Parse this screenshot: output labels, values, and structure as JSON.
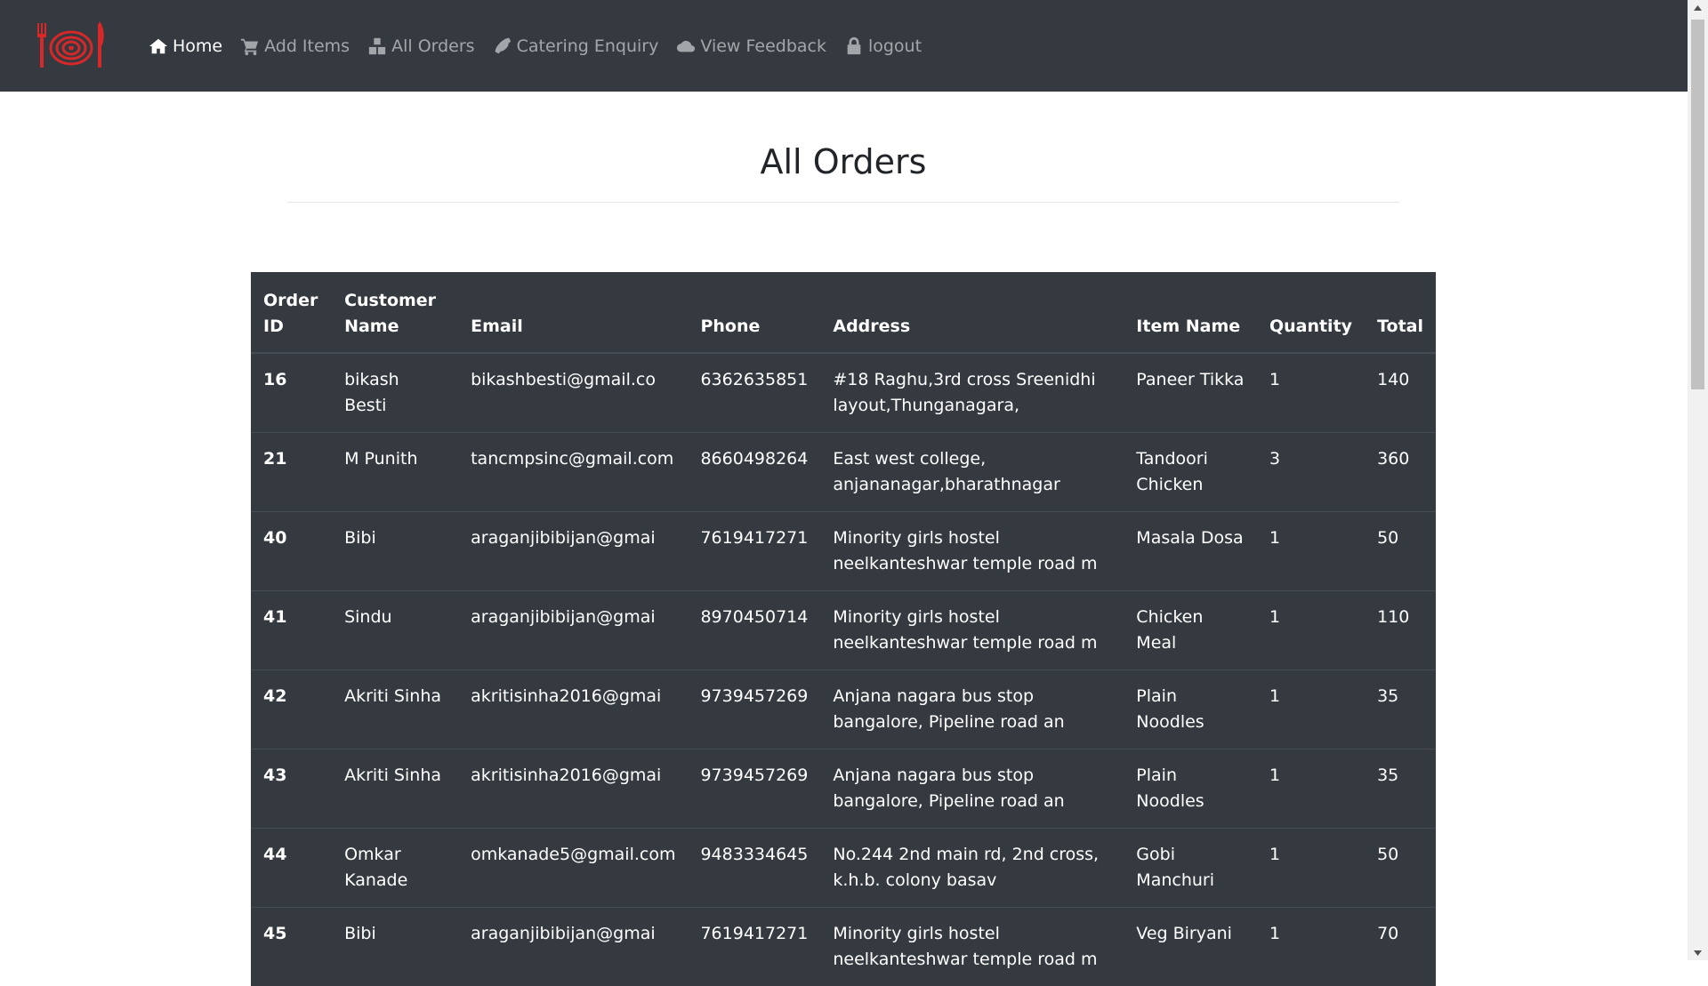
{
  "nav": {
    "items": [
      {
        "label": "Home",
        "icon": "home-icon",
        "active": true
      },
      {
        "label": "Add Items",
        "icon": "cart-icon",
        "active": false
      },
      {
        "label": "All Orders",
        "icon": "cubes-icon",
        "active": false
      },
      {
        "label": "Catering Enquiry",
        "icon": "phone-icon",
        "active": false
      },
      {
        "label": "View Feedback",
        "icon": "cloud-icon",
        "active": false
      },
      {
        "label": "logout",
        "icon": "lock-icon",
        "active": false
      }
    ]
  },
  "page": {
    "title": "All Orders"
  },
  "table": {
    "headers": [
      "Order ID",
      "Customer Name",
      "Email",
      "Phone",
      "Address",
      "Item Name",
      "Quantity",
      "Total"
    ],
    "rows": [
      [
        "16",
        "bikash Besti",
        "bikashbesti@gmail.co",
        "6362635851",
        "#18 Raghu,3rd cross Sreenidhi layout,Thunganagara,",
        "Paneer Tikka",
        "1",
        "140"
      ],
      [
        "21",
        "M Punith",
        "tancmpsinc@gmail.com",
        "8660498264",
        "East west college, anjananagar,bharathnagar",
        "Tandoori Chicken",
        "3",
        "360"
      ],
      [
        "40",
        "Bibi",
        "araganjibibijan@gmai",
        "7619417271",
        "Minority girls hostel neelkanteshwar temple road m",
        "Masala Dosa",
        "1",
        "50"
      ],
      [
        "41",
        "Sindu",
        "araganjibibijan@gmai",
        "8970450714",
        "Minority girls hostel neelkanteshwar temple road m",
        "Chicken Meal",
        "1",
        "110"
      ],
      [
        "42",
        "Akriti Sinha",
        "akritisinha2016@gmai",
        "9739457269",
        "Anjana nagara bus stop bangalore, Pipeline road an",
        "Plain Noodles",
        "1",
        "35"
      ],
      [
        "43",
        "Akriti Sinha",
        "akritisinha2016@gmai",
        "9739457269",
        "Anjana nagara bus stop bangalore, Pipeline road an",
        "Plain Noodles",
        "1",
        "35"
      ],
      [
        "44",
        "Omkar Kanade",
        "omkanade5@gmail.com",
        "9483334645",
        "No.244 2nd main rd, 2nd cross, k.h.b. colony basav",
        "Gobi Manchuri",
        "1",
        "50"
      ],
      [
        "45",
        "Bibi",
        "araganjibibijan@gmai",
        "7619417271",
        "Minority girls hostel neelkanteshwar temple road m",
        "Veg Biryani",
        "1",
        "70"
      ]
    ]
  },
  "colors": {
    "navbar_bg": "#343a40",
    "table_bg": "#343a40",
    "logo_red": "#d62828",
    "nav_text": "rgba(255,255,255,0.55)",
    "nav_active": "#ffffff"
  }
}
